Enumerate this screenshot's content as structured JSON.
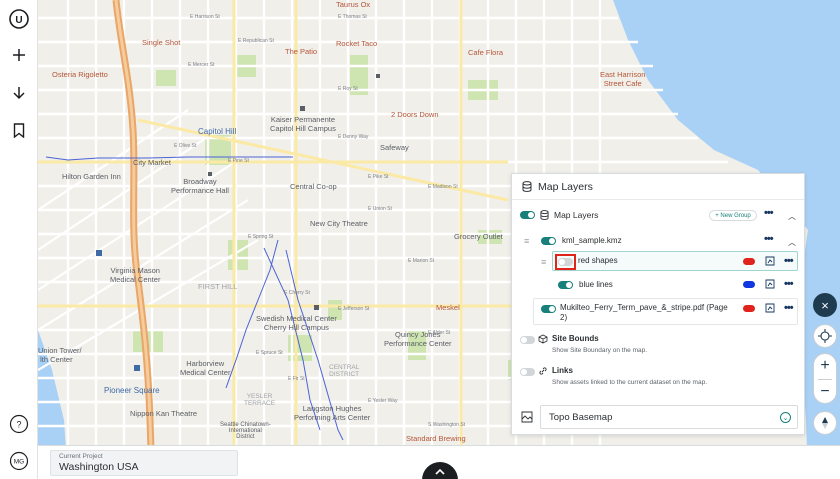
{
  "rail": {
    "logo_letter": "U",
    "avatar_initials": "MG",
    "help_label": "?"
  },
  "map": {
    "labels_poi": [
      {
        "text": "Single Shot"
      },
      {
        "text": "The Patio"
      },
      {
        "text": "Rocket Taco"
      },
      {
        "text": "Taurus Ox"
      },
      {
        "text": "Cafe Flora"
      },
      {
        "text": "Osteria Rigoletto"
      },
      {
        "text": "Kaiser Permanente\nCapitol Hill Campus"
      },
      {
        "text": "City Market"
      },
      {
        "text": "Hilton Garden Inn"
      },
      {
        "text": "Broadway\nPerformance Hall"
      },
      {
        "text": "Central Co-op"
      },
      {
        "text": "Safeway"
      },
      {
        "text": "New City Theatre"
      },
      {
        "text": "Grocery Outlet"
      },
      {
        "text": "Virginia Mason\nMedical Center"
      },
      {
        "text": "FIRST HILL"
      },
      {
        "text": "Swedish Medical Center\nCherry Hill Campus"
      },
      {
        "text": "Quincy Jones\nPerformance Center"
      },
      {
        "text": "Harborview\nMedical Center"
      },
      {
        "text": "Union Tower/\n lth Center"
      },
      {
        "text": "Nippon Kan Theatre"
      },
      {
        "text": "Langston Hughes\nPerforming Arts Center"
      },
      {
        "text": "Seattle Chinatown-\nInternational\nDistrict"
      },
      {
        "text": "CENTRAL\nDISTRICT"
      },
      {
        "text": "YESLER\nTERRACE"
      }
    ],
    "labels_red": [
      {
        "text": "2 Doors Down"
      },
      {
        "text": "Meskel"
      },
      {
        "text": "East Harrison\nStreet Cafe"
      },
      {
        "text": "Standard Brewing"
      }
    ],
    "labels_blue": [
      {
        "text": "Capitol Hill"
      },
      {
        "text": "Pioneer Square"
      }
    ],
    "streets": [
      {
        "text": "E Thomas St"
      },
      {
        "text": "E Harrison St"
      },
      {
        "text": "E Republican St"
      },
      {
        "text": "E Mercer St"
      },
      {
        "text": "E Roy St"
      },
      {
        "text": "E Denny Way"
      },
      {
        "text": "E Olive St"
      },
      {
        "text": "E Pine St"
      },
      {
        "text": "E Pike St"
      },
      {
        "text": "E Union St"
      },
      {
        "text": "E Madison St"
      },
      {
        "text": "E Spring St"
      },
      {
        "text": "E Marion St"
      },
      {
        "text": "E Cherry St"
      },
      {
        "text": "E Jefferson St"
      },
      {
        "text": "E Alder St"
      },
      {
        "text": "E Spruce St"
      },
      {
        "text": "E Fir St"
      },
      {
        "text": "E Yesler Way"
      },
      {
        "text": "S Washington St"
      }
    ]
  },
  "panel": {
    "title": "Map Layers",
    "group_label": "Map Layers",
    "new_group": "+ New Group",
    "layers": [
      {
        "name": "kml_sample.kmz"
      },
      {
        "name": "red shapes",
        "color": "#e0241b"
      },
      {
        "name": "blue lines",
        "color": "#1038e0"
      },
      {
        "name": "Mukilteo_Ferry_Term_pave_&_stripe.pdf (Page 2)",
        "color": "#e0241b"
      }
    ],
    "site_bounds": {
      "label": "Site Bounds",
      "desc": "Show Site Boundary on the map."
    },
    "links": {
      "label": "Links",
      "desc": "Show assets linked to the current dataset on the map."
    },
    "basemap": "Topo Basemap"
  },
  "controls": {
    "close": "×",
    "zoom_in": "+",
    "zoom_out": "−",
    "compass": "N"
  },
  "bottom": {
    "project_caption": "Current Project",
    "project_name": "Washington USA"
  },
  "colors": {
    "accent": "#18807a",
    "navy": "#1f3b4f",
    "water": "#a9d0f5",
    "park": "#cfe5b1",
    "highway": "#e8a66b"
  }
}
